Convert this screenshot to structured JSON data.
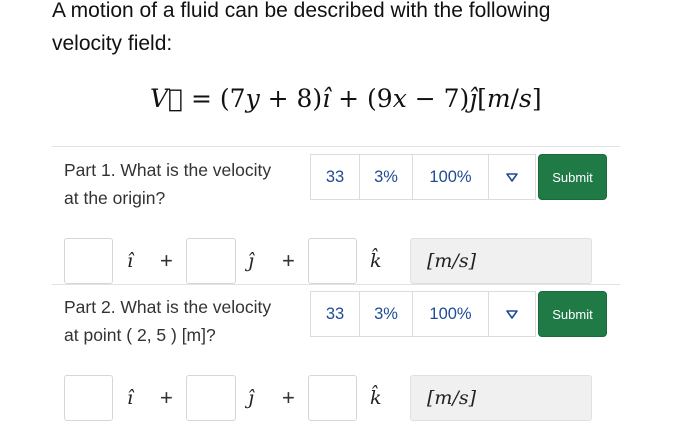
{
  "intro": {
    "line1": "A motion of a fluid can be described with the following",
    "line2": "velocity field:"
  },
  "equation": {
    "lhs": "V⃗",
    "eq": " = (7",
    "y": "y",
    "a": " + 8)",
    "ihat": "î",
    "b": " + (9",
    "x": "x",
    "c": " − 7)",
    "jhat": "ĵ",
    "d": "[",
    "m": "m",
    "slash": "/",
    "s": "s",
    "e": "]"
  },
  "parts": [
    {
      "line1": "Part 1. What is the velocity",
      "line2": "at the origin?",
      "stats": {
        "attempts": "33",
        "penalty": "3%",
        "score": "100%"
      },
      "submit_label": "Submit",
      "i_hat": "î",
      "j_hat": "ĵ",
      "k_hat": "k̂",
      "plus": "+",
      "unit": "[m/s]"
    },
    {
      "line1": "Part 2. What is the velocity",
      "line2": "at point ( 2, 5 ) [m]?",
      "stats": {
        "attempts": "33",
        "penalty": "3%",
        "score": "100%"
      },
      "submit_label": "Submit",
      "i_hat": "î",
      "j_hat": "ĵ",
      "k_hat": "k̂",
      "plus": "+",
      "unit": "[m/s]"
    }
  ],
  "icons": {
    "dropdown": "triangle-down-outline-icon"
  },
  "colors": {
    "submit_bg": "#1f7a46",
    "stat_text": "#1f4b99"
  }
}
